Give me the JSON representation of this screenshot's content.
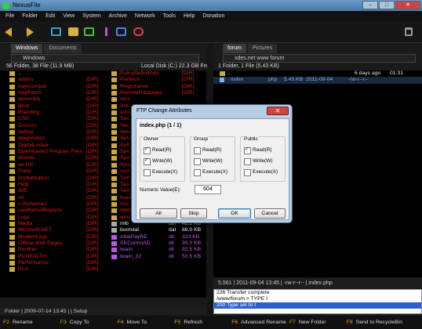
{
  "window": {
    "title": "NexusFile",
    "min": "–",
    "max": "□",
    "close": "✕"
  },
  "menu": [
    "File",
    "Folder",
    "Edit",
    "View",
    "System",
    "Archive",
    "Network",
    "Tools",
    "Help",
    "Donation"
  ],
  "toolbar_icons": [
    "back-icon",
    "forward-icon",
    "panel-icon",
    "folder-icon",
    "photo-icon",
    "music-icon",
    "video-icon",
    "favorite-icon",
    "trash-icon"
  ],
  "left": {
    "tabs": [
      "Windows",
      "Documents"
    ],
    "address": "Windows",
    "summary": "56 Folder, 38 File (11.9 MB)",
    "disk": "Local Disk (C:) 22.3 GB Free",
    "col1": [
      {
        "name": "..",
        "type": "",
        "cls": "white"
      },
      {
        "name": "addins",
        "type": "[DIR]",
        "cls": "red"
      },
      {
        "name": "AppCompat",
        "type": "[DIR]",
        "cls": "red"
      },
      {
        "name": "AppPatch",
        "type": "[DIR]",
        "cls": "red"
      },
      {
        "name": "assembly",
        "type": "[DIR]",
        "cls": "red"
      },
      {
        "name": "Boot",
        "type": "[DIR]",
        "cls": "red"
      },
      {
        "name": "Branding",
        "type": "[DIR]",
        "cls": "red"
      },
      {
        "name": "CSC",
        "type": "[DIR]",
        "cls": "red"
      },
      {
        "name": "Cursors",
        "type": "[DIR]",
        "cls": "red"
      },
      {
        "name": "debug",
        "type": "[DIR]",
        "cls": "red"
      },
      {
        "name": "diagnostics",
        "type": "[DIR]",
        "cls": "red"
      },
      {
        "name": "DigitalLocker",
        "type": "[DIR]",
        "cls": "red"
      },
      {
        "name": "Downloaded Program Files",
        "type": "[DIR]",
        "cls": "red"
      },
      {
        "name": "ehome",
        "type": "[DIR]",
        "cls": "red"
      },
      {
        "name": "en-US",
        "type": "[DIR]",
        "cls": "red"
      },
      {
        "name": "Fonts",
        "type": "[DIR]",
        "cls": "red"
      },
      {
        "name": "Globalization",
        "type": "[DIR]",
        "cls": "red"
      },
      {
        "name": "Help",
        "type": "[DIR]",
        "cls": "red"
      },
      {
        "name": "IME",
        "type": "[DIR]",
        "cls": "red"
      },
      {
        "name": "inf",
        "type": "[DIR]",
        "cls": "red"
      },
      {
        "name": "L2Schemas",
        "type": "[DIR]",
        "cls": "red"
      },
      {
        "name": "LiveKernelReports",
        "type": "[DIR]",
        "cls": "red"
      },
      {
        "name": "Logs",
        "type": "[DIR]",
        "cls": "red"
      },
      {
        "name": "Media",
        "type": "[DIR]",
        "cls": "red"
      },
      {
        "name": "Microsoft.NET",
        "type": "[DIR]",
        "cls": "red"
      },
      {
        "name": "ModemLogs",
        "type": "[DIR]",
        "cls": "red"
      },
      {
        "name": "Offline Web Pages",
        "type": "[DIR]",
        "cls": "red"
      },
      {
        "name": "Panther",
        "type": "[DIR]",
        "cls": "red"
      },
      {
        "name": "PCHEALTH",
        "type": "[DIR]",
        "cls": "red"
      },
      {
        "name": "Performance",
        "type": "[DIR]",
        "cls": "red"
      },
      {
        "name": "PLA",
        "type": "[DIR]",
        "cls": "red"
      }
    ],
    "col2": [
      {
        "name": "PolicyDefinitions",
        "type": "",
        "size": "[DIR]",
        "cls": "red"
      },
      {
        "name": "Prefetch",
        "type": "",
        "size": "[DIR]",
        "cls": "red"
      },
      {
        "name": "Registration",
        "type": "",
        "size": "[DIR]",
        "cls": "red"
      },
      {
        "name": "RemotePackages",
        "type": "",
        "size": "[DIR]",
        "cls": "red"
      },
      {
        "name": "resc",
        "type": "",
        "size": "",
        "cls": "red"
      },
      {
        "name": "Sch",
        "type": "",
        "size": "",
        "cls": "red"
      },
      {
        "name": "sche",
        "type": "",
        "size": "",
        "cls": "red"
      },
      {
        "name": "Sec",
        "type": "",
        "size": "",
        "cls": "red"
      },
      {
        "name": "Sec",
        "type": "",
        "size": "",
        "cls": "red"
      },
      {
        "name": "Serv",
        "type": "",
        "size": "",
        "cls": "red"
      },
      {
        "name": "Setu",
        "type": "",
        "size": "",
        "cls": "red"
      },
      {
        "name": "Soft",
        "type": "",
        "size": "",
        "cls": "red"
      },
      {
        "name": "Spe",
        "type": "",
        "size": "",
        "cls": "red"
      },
      {
        "name": "Syst",
        "type": "",
        "size": "",
        "cls": "red"
      },
      {
        "name": "Syst",
        "type": "",
        "size": "",
        "cls": "red"
      },
      {
        "name": "syst",
        "type": "",
        "size": "",
        "cls": "red"
      },
      {
        "name": "TAP",
        "type": "",
        "size": "",
        "cls": "red"
      },
      {
        "name": "Tasi",
        "type": "",
        "size": "",
        "cls": "red"
      },
      {
        "name": "Tem",
        "type": "",
        "size": "",
        "cls": "red"
      },
      {
        "name": "twain_32",
        "type": "",
        "size": "[DIR]",
        "cls": "red"
      },
      {
        "name": "Vss",
        "type": "",
        "size": "[DIR]",
        "cls": "red"
      },
      {
        "name": "Web",
        "type": "",
        "size": "[DIR]",
        "cls": "red"
      },
      {
        "name": "winsxs",
        "type": "",
        "size": "[DIR]",
        "cls": "red"
      },
      {
        "name": "mib",
        "type": "bin",
        "size": "42.1 KB",
        "cls": "white"
      },
      {
        "name": "bootstat",
        "type": "dat",
        "size": "66.0 KB",
        "cls": "white"
      },
      {
        "name": "AltatPayRE",
        "type": "dll",
        "size": "323 KB",
        "cls": "purple"
      },
      {
        "name": "SKCommAD",
        "type": "dll",
        "size": "95.0 KB",
        "cls": "purple"
      },
      {
        "name": "twain",
        "type": "dll",
        "size": "92.5 KB",
        "cls": "purple"
      },
      {
        "name": "twain_32",
        "type": "dll",
        "size": "50.5 KB",
        "cls": "purple"
      }
    ],
    "status": "Folder | 2009-07-14 13:45 | | Setup"
  },
  "right": {
    "tabs": [
      "forum",
      "Pictures"
    ],
    "address": "xdes.net  www  forum",
    "summary": "1 Folder, 1 File (5.43 KB)",
    "rows": [
      {
        "name": "..",
        "ext": "",
        "size": "6 days ago",
        "date": "01:31",
        "attr": ""
      },
      {
        "name": "index",
        "ext": "php",
        "size": "5.43 KB",
        "date": "2011-09-04",
        "attr": "-rw-r--r--"
      }
    ],
    "status": "5,561 | 2011-09-04 13:45 | -rw-r--r-- | index.php",
    "log": [
      "226 Transfer complete",
      "/www/forum > TYPE I",
      "200 Type set to I"
    ]
  },
  "fkeys": [
    {
      "key": "F2",
      "label": "Rename"
    },
    {
      "key": "F3",
      "label": "Copy To"
    },
    {
      "key": "F4",
      "label": "Move To"
    },
    {
      "key": "F5",
      "label": "Refresh"
    },
    {
      "key": "F6",
      "label": "Advanced Rename"
    },
    {
      "key": "F7",
      "label": "New Folder"
    },
    {
      "key": "F8",
      "label": "Send to RecycleBin"
    }
  ],
  "dialog": {
    "title": "FTP Change Attributes",
    "heading": "index.php (1 / 1)",
    "groups": [
      {
        "label": "Owner",
        "read": true,
        "write": true,
        "exec": false
      },
      {
        "label": "Group",
        "read": false,
        "write": false,
        "exec": false
      },
      {
        "label": "Public",
        "read": true,
        "write": false,
        "exec": false
      }
    ],
    "read_label": "Read(R)",
    "write_label": "Write(W)",
    "exec_label": "Execute(X)",
    "numeric_label": "Numeric Value(E):",
    "numeric_value": "604",
    "buttons": {
      "all": "All",
      "skip": "Skip",
      "ok": "OK",
      "cancel": "Cancel"
    }
  }
}
